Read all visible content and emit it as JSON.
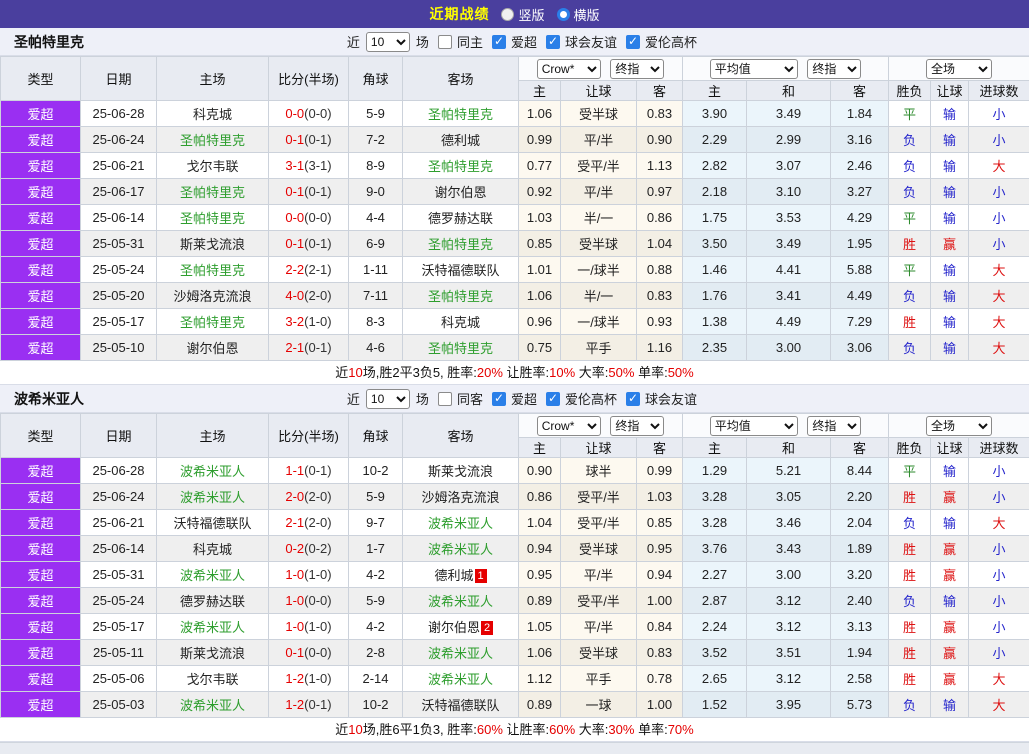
{
  "topbar": {
    "title": "近期战绩",
    "layout_options": [
      {
        "label": "竖版",
        "checked": false
      },
      {
        "label": "横版",
        "checked": true
      }
    ]
  },
  "colors": {
    "topbar_bg": "#4a3f9e",
    "title_text": "#ffff00",
    "league_cell_bg": "#9a2ff2",
    "subject_team": "#2e9e2e",
    "score_red": "#e50000",
    "win_red": "#dd1111",
    "draw_green": "#2b8a2b",
    "loss_blue": "#2525cc",
    "checkbox_blue": "#2a7fe8",
    "odds_col_bg": "#fdf9f0",
    "avg_col_bg": "#ebf5fb",
    "header_bg": "#e8ebf2"
  },
  "headers": {
    "type": "类型",
    "date": "日期",
    "home": "主场",
    "score": "比分(半场)",
    "corners": "角球",
    "away": "客场",
    "home_odds": "主",
    "handicap": "让球",
    "away_odds": "客",
    "avg_home": "主",
    "avg_draw": "和",
    "avg_away": "客",
    "result": "胜负",
    "handicap_result": "让球",
    "goals": "进球数"
  },
  "selects": {
    "crow": "Crow*",
    "final": "终指",
    "average": "平均值",
    "final2": "终指",
    "fulltime": "全场"
  },
  "value_colors": {
    "胜": "win",
    "平": "draw",
    "负": "loss",
    "赢": "win",
    "输": "loss",
    "大": "win",
    "小": "loss"
  },
  "sections": [
    {
      "team": "圣帕特里克",
      "filters": {
        "prefix": "近",
        "match_count": "10",
        "suffix": "场",
        "checkboxes": [
          {
            "label": "同主",
            "checked": false
          },
          {
            "label": "爱超",
            "checked": true
          },
          {
            "label": "球会友谊",
            "checked": true
          },
          {
            "label": "爱伦高杯",
            "checked": true
          }
        ]
      },
      "rows": [
        {
          "league": "爱超",
          "date": "25-06-28",
          "home": "科克城",
          "home_subject": false,
          "score": "0-0",
          "half": "(0-0)",
          "corners": "5-9",
          "away": "圣帕特里克",
          "away_subject": true,
          "away_badge": "",
          "crow_home": "1.06",
          "handicap": "受半球",
          "crow_away": "0.83",
          "avg_home": "3.90",
          "avg_draw": "3.49",
          "avg_away": "1.84",
          "result": "平",
          "handicap_result": "输",
          "goals_result": "小"
        },
        {
          "league": "爱超",
          "date": "25-06-24",
          "home": "圣帕特里克",
          "home_subject": true,
          "score": "0-1",
          "half": "(0-1)",
          "corners": "7-2",
          "away": "德利城",
          "away_subject": false,
          "away_badge": "",
          "crow_home": "0.99",
          "handicap": "平/半",
          "crow_away": "0.90",
          "avg_home": "2.29",
          "avg_draw": "2.99",
          "avg_away": "3.16",
          "result": "负",
          "handicap_result": "输",
          "goals_result": "小"
        },
        {
          "league": "爱超",
          "date": "25-06-21",
          "home": "戈尔韦联",
          "home_subject": false,
          "score": "3-1",
          "half": "(3-1)",
          "corners": "8-9",
          "away": "圣帕特里克",
          "away_subject": true,
          "away_badge": "",
          "crow_home": "0.77",
          "handicap": "受平/半",
          "crow_away": "1.13",
          "avg_home": "2.82",
          "avg_draw": "3.07",
          "avg_away": "2.46",
          "result": "负",
          "handicap_result": "输",
          "goals_result": "大"
        },
        {
          "league": "爱超",
          "date": "25-06-17",
          "home": "圣帕特里克",
          "home_subject": true,
          "score": "0-1",
          "half": "(0-1)",
          "corners": "9-0",
          "away": "谢尔伯恩",
          "away_subject": false,
          "away_badge": "",
          "crow_home": "0.92",
          "handicap": "平/半",
          "crow_away": "0.97",
          "avg_home": "2.18",
          "avg_draw": "3.10",
          "avg_away": "3.27",
          "result": "负",
          "handicap_result": "输",
          "goals_result": "小"
        },
        {
          "league": "爱超",
          "date": "25-06-14",
          "home": "圣帕特里克",
          "home_subject": true,
          "score": "0-0",
          "half": "(0-0)",
          "corners": "4-4",
          "away": "德罗赫达联",
          "away_subject": false,
          "away_badge": "",
          "crow_home": "1.03",
          "handicap": "半/一",
          "crow_away": "0.86",
          "avg_home": "1.75",
          "avg_draw": "3.53",
          "avg_away": "4.29",
          "result": "平",
          "handicap_result": "输",
          "goals_result": "小"
        },
        {
          "league": "爱超",
          "date": "25-05-31",
          "home": "斯莱戈流浪",
          "home_subject": false,
          "score": "0-1",
          "half": "(0-1)",
          "corners": "6-9",
          "away": "圣帕特里克",
          "away_subject": true,
          "away_badge": "",
          "crow_home": "0.85",
          "handicap": "受半球",
          "crow_away": "1.04",
          "avg_home": "3.50",
          "avg_draw": "3.49",
          "avg_away": "1.95",
          "result": "胜",
          "handicap_result": "赢",
          "goals_result": "小"
        },
        {
          "league": "爱超",
          "date": "25-05-24",
          "home": "圣帕特里克",
          "home_subject": true,
          "score": "2-2",
          "half": "(2-1)",
          "corners": "1-11",
          "away": "沃特福德联队",
          "away_subject": false,
          "away_badge": "",
          "crow_home": "1.01",
          "handicap": "一/球半",
          "crow_away": "0.88",
          "avg_home": "1.46",
          "avg_draw": "4.41",
          "avg_away": "5.88",
          "result": "平",
          "handicap_result": "输",
          "goals_result": "大"
        },
        {
          "league": "爱超",
          "date": "25-05-20",
          "home": "沙姆洛克流浪",
          "home_subject": false,
          "score": "4-0",
          "half": "(2-0)",
          "corners": "7-11",
          "away": "圣帕特里克",
          "away_subject": true,
          "away_badge": "",
          "crow_home": "1.06",
          "handicap": "半/一",
          "crow_away": "0.83",
          "avg_home": "1.76",
          "avg_draw": "3.41",
          "avg_away": "4.49",
          "result": "负",
          "handicap_result": "输",
          "goals_result": "大"
        },
        {
          "league": "爱超",
          "date": "25-05-17",
          "home": "圣帕特里克",
          "home_subject": true,
          "score": "3-2",
          "half": "(1-0)",
          "corners": "8-3",
          "away": "科克城",
          "away_subject": false,
          "away_badge": "",
          "crow_home": "0.96",
          "handicap": "一/球半",
          "crow_away": "0.93",
          "avg_home": "1.38",
          "avg_draw": "4.49",
          "avg_away": "7.29",
          "result": "胜",
          "handicap_result": "输",
          "goals_result": "大"
        },
        {
          "league": "爱超",
          "date": "25-05-10",
          "home": "谢尔伯恩",
          "home_subject": false,
          "score": "2-1",
          "half": "(0-1)",
          "corners": "4-6",
          "away": "圣帕特里克",
          "away_subject": true,
          "away_badge": "",
          "crow_home": "0.75",
          "handicap": "平手",
          "crow_away": "1.16",
          "avg_home": "2.35",
          "avg_draw": "3.00",
          "avg_away": "3.06",
          "result": "负",
          "handicap_result": "输",
          "goals_result": "大"
        }
      ],
      "summary": [
        {
          "text": "近"
        },
        {
          "text": "10",
          "red": true
        },
        {
          "text": "场,胜2平3负5, 胜率:"
        },
        {
          "text": "20%",
          "red": true
        },
        {
          "text": " 让胜率:"
        },
        {
          "text": "10%",
          "red": true
        },
        {
          "text": " 大率:"
        },
        {
          "text": "50%",
          "red": true
        },
        {
          "text": " 单率:"
        },
        {
          "text": "50%",
          "red": true
        }
      ]
    },
    {
      "team": "波希米亚人",
      "filters": {
        "prefix": "近",
        "match_count": "10",
        "suffix": "场",
        "checkboxes": [
          {
            "label": "同客",
            "checked": false
          },
          {
            "label": "爱超",
            "checked": true
          },
          {
            "label": "爱伦高杯",
            "checked": true
          },
          {
            "label": "球会友谊",
            "checked": true
          }
        ]
      },
      "rows": [
        {
          "league": "爱超",
          "date": "25-06-28",
          "home": "波希米亚人",
          "home_subject": true,
          "score": "1-1",
          "half": "(0-1)",
          "corners": "10-2",
          "away": "斯莱戈流浪",
          "away_subject": false,
          "away_badge": "",
          "crow_home": "0.90",
          "handicap": "球半",
          "crow_away": "0.99",
          "avg_home": "1.29",
          "avg_draw": "5.21",
          "avg_away": "8.44",
          "result": "平",
          "handicap_result": "输",
          "goals_result": "小"
        },
        {
          "league": "爱超",
          "date": "25-06-24",
          "home": "波希米亚人",
          "home_subject": true,
          "score": "2-0",
          "half": "(2-0)",
          "corners": "5-9",
          "away": "沙姆洛克流浪",
          "away_subject": false,
          "away_badge": "",
          "crow_home": "0.86",
          "handicap": "受平/半",
          "crow_away": "1.03",
          "avg_home": "3.28",
          "avg_draw": "3.05",
          "avg_away": "2.20",
          "result": "胜",
          "handicap_result": "赢",
          "goals_result": "小"
        },
        {
          "league": "爱超",
          "date": "25-06-21",
          "home": "沃特福德联队",
          "home_subject": false,
          "score": "2-1",
          "half": "(2-0)",
          "corners": "9-7",
          "away": "波希米亚人",
          "away_subject": true,
          "away_badge": "",
          "crow_home": "1.04",
          "handicap": "受平/半",
          "crow_away": "0.85",
          "avg_home": "3.28",
          "avg_draw": "3.46",
          "avg_away": "2.04",
          "result": "负",
          "handicap_result": "输",
          "goals_result": "大"
        },
        {
          "league": "爱超",
          "date": "25-06-14",
          "home": "科克城",
          "home_subject": false,
          "score": "0-2",
          "half": "(0-2)",
          "corners": "1-7",
          "away": "波希米亚人",
          "away_subject": true,
          "away_badge": "",
          "crow_home": "0.94",
          "handicap": "受半球",
          "crow_away": "0.95",
          "avg_home": "3.76",
          "avg_draw": "3.43",
          "avg_away": "1.89",
          "result": "胜",
          "handicap_result": "赢",
          "goals_result": "小"
        },
        {
          "league": "爱超",
          "date": "25-05-31",
          "home": "波希米亚人",
          "home_subject": true,
          "score": "1-0",
          "half": "(1-0)",
          "corners": "4-2",
          "away": "德利城",
          "away_subject": false,
          "away_badge": "1",
          "crow_home": "0.95",
          "handicap": "平/半",
          "crow_away": "0.94",
          "avg_home": "2.27",
          "avg_draw": "3.00",
          "avg_away": "3.20",
          "result": "胜",
          "handicap_result": "赢",
          "goals_result": "小"
        },
        {
          "league": "爱超",
          "date": "25-05-24",
          "home": "德罗赫达联",
          "home_subject": false,
          "score": "1-0",
          "half": "(0-0)",
          "corners": "5-9",
          "away": "波希米亚人",
          "away_subject": true,
          "away_badge": "",
          "crow_home": "0.89",
          "handicap": "受平/半",
          "crow_away": "1.00",
          "avg_home": "2.87",
          "avg_draw": "3.12",
          "avg_away": "2.40",
          "result": "负",
          "handicap_result": "输",
          "goals_result": "小"
        },
        {
          "league": "爱超",
          "date": "25-05-17",
          "home": "波希米亚人",
          "home_subject": true,
          "score": "1-0",
          "half": "(1-0)",
          "corners": "4-2",
          "away": "谢尔伯恩",
          "away_subject": false,
          "away_badge": "2",
          "crow_home": "1.05",
          "handicap": "平/半",
          "crow_away": "0.84",
          "avg_home": "2.24",
          "avg_draw": "3.12",
          "avg_away": "3.13",
          "result": "胜",
          "handicap_result": "赢",
          "goals_result": "小"
        },
        {
          "league": "爱超",
          "date": "25-05-11",
          "home": "斯莱戈流浪",
          "home_subject": false,
          "score": "0-1",
          "half": "(0-0)",
          "corners": "2-8",
          "away": "波希米亚人",
          "away_subject": true,
          "away_badge": "",
          "crow_home": "1.06",
          "handicap": "受半球",
          "crow_away": "0.83",
          "avg_home": "3.52",
          "avg_draw": "3.51",
          "avg_away": "1.94",
          "result": "胜",
          "handicap_result": "赢",
          "goals_result": "小"
        },
        {
          "league": "爱超",
          "date": "25-05-06",
          "home": "戈尔韦联",
          "home_subject": false,
          "score": "1-2",
          "half": "(1-0)",
          "corners": "2-14",
          "away": "波希米亚人",
          "away_subject": true,
          "away_badge": "",
          "crow_home": "1.12",
          "handicap": "平手",
          "crow_away": "0.78",
          "avg_home": "2.65",
          "avg_draw": "3.12",
          "avg_away": "2.58",
          "result": "胜",
          "handicap_result": "赢",
          "goals_result": "大"
        },
        {
          "league": "爱超",
          "date": "25-05-03",
          "home": "波希米亚人",
          "home_subject": true,
          "score": "1-2",
          "half": "(0-1)",
          "corners": "10-2",
          "away": "沃特福德联队",
          "away_subject": false,
          "away_badge": "",
          "crow_home": "0.89",
          "handicap": "一球",
          "crow_away": "1.00",
          "avg_home": "1.52",
          "avg_draw": "3.95",
          "avg_away": "5.73",
          "result": "负",
          "handicap_result": "输",
          "goals_result": "大"
        }
      ],
      "summary": [
        {
          "text": "近"
        },
        {
          "text": "10",
          "red": true
        },
        {
          "text": "场,胜6平1负3, 胜率:"
        },
        {
          "text": "60%",
          "red": true
        },
        {
          "text": " 让胜率:"
        },
        {
          "text": "60%",
          "red": true
        },
        {
          "text": " 大率:"
        },
        {
          "text": "30%",
          "red": true
        },
        {
          "text": " 单率:"
        },
        {
          "text": "70%",
          "red": true
        }
      ]
    }
  ]
}
